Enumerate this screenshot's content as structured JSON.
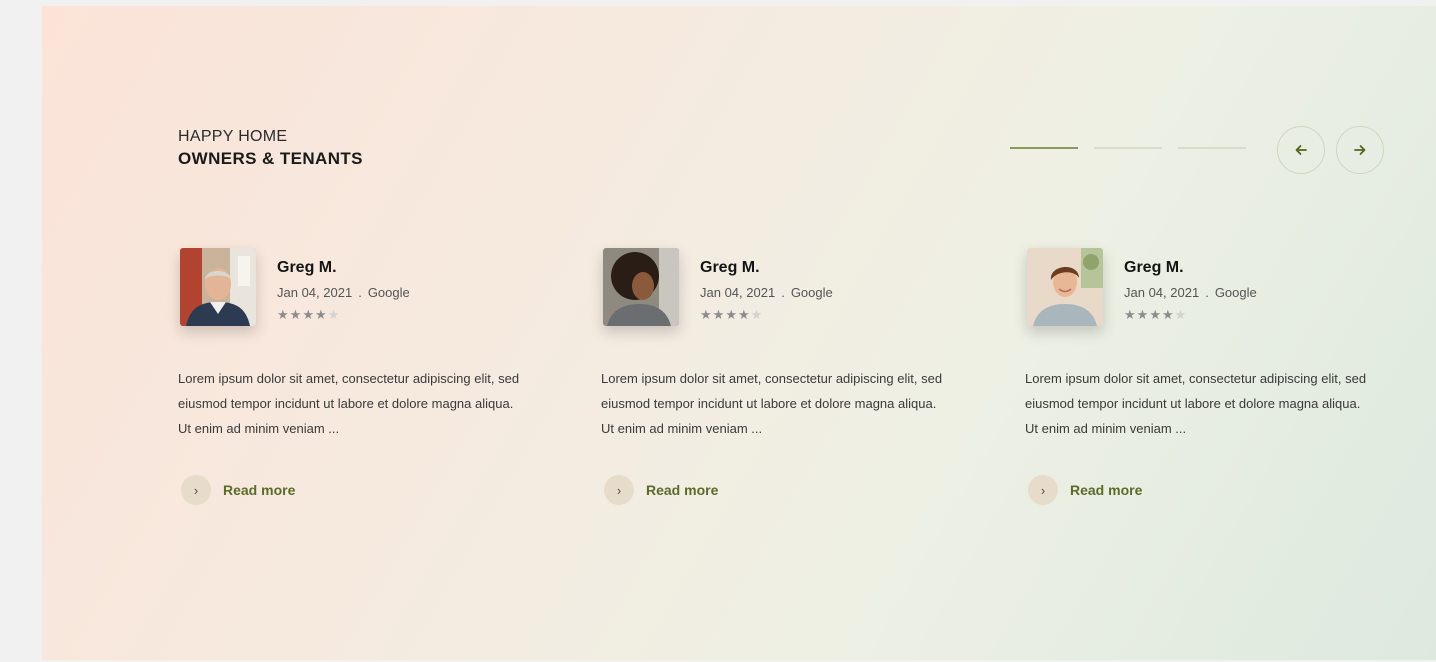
{
  "heading": {
    "eyebrow": "HAPPY HOME",
    "title": "OWNERS & TENANTS"
  },
  "pager": {
    "count": 3,
    "active_index": 0
  },
  "nav": {
    "prev_icon": "arrow-left-icon",
    "next_icon": "arrow-right-icon"
  },
  "testimonials": [
    {
      "name": "Greg M.",
      "date": "Jan 04, 2021",
      "source": "Google",
      "separator": ".",
      "rating": 4,
      "max_rating": 5,
      "text": "Lorem ipsum dolor sit amet, consectetur adipiscing elit, sed eiusmod tempor incidunt ut labore et dolore magna aliqua. Ut enim ad minim veniam ...",
      "read_more": "Read more"
    },
    {
      "name": "Greg M.",
      "date": "Jan 04, 2021",
      "source": "Google",
      "separator": ".",
      "rating": 4,
      "max_rating": 5,
      "text": "Lorem ipsum dolor sit amet, consectetur adipiscing elit, sed eiusmod tempor incidunt ut labore et dolore magna aliqua. Ut enim ad minim veniam ...",
      "read_more": "Read more"
    },
    {
      "name": "Greg M.",
      "date": "Jan 04, 2021",
      "source": "Google",
      "separator": ".",
      "rating": 4,
      "max_rating": 5,
      "text": "Lorem ipsum dolor sit amet, consectetur adipiscing elit, sed eiusmod tempor incidunt ut labore et dolore magna aliqua. Ut enim ad minim veniam ...",
      "read_more": "Read more"
    }
  ],
  "colors": {
    "accent": "#5b6b2a",
    "pager_active": "#8a9a5e",
    "pager_inactive": "#d9dccb"
  }
}
